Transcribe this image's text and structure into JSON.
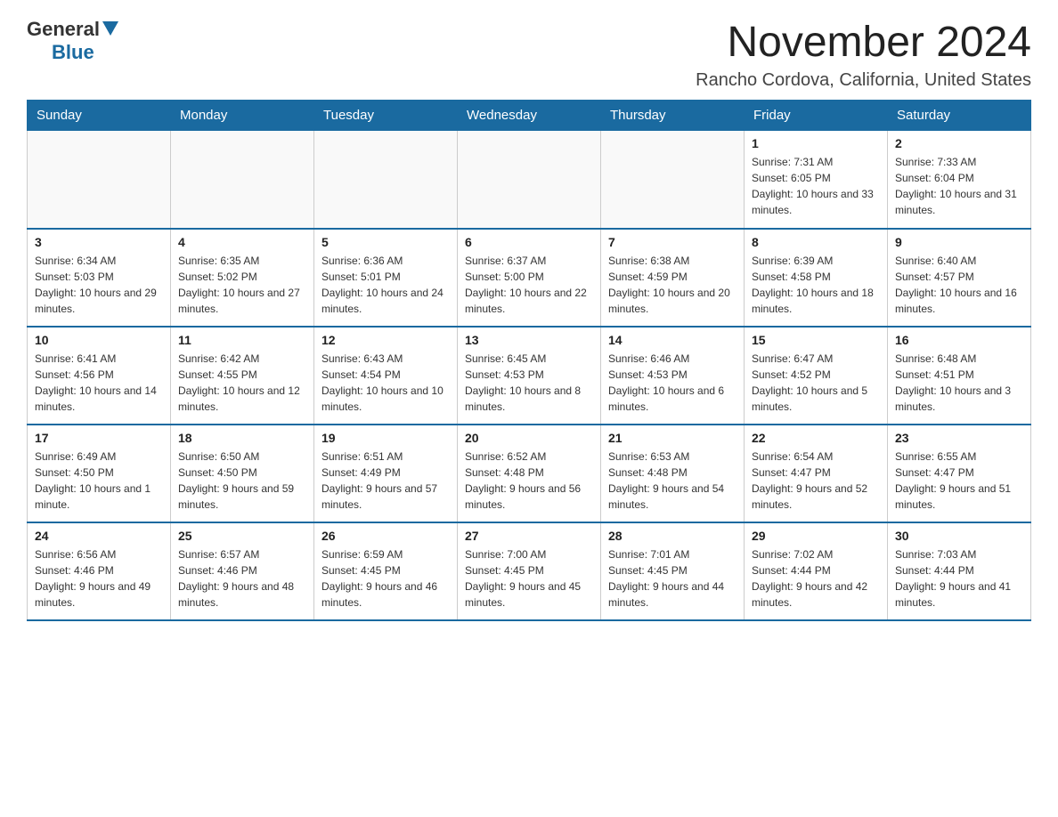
{
  "logo": {
    "general": "General",
    "blue": "Blue"
  },
  "header": {
    "month_title": "November 2024",
    "location": "Rancho Cordova, California, United States"
  },
  "days_of_week": [
    "Sunday",
    "Monday",
    "Tuesday",
    "Wednesday",
    "Thursday",
    "Friday",
    "Saturday"
  ],
  "weeks": [
    [
      {
        "day": "",
        "sunrise": "",
        "sunset": "",
        "daylight": ""
      },
      {
        "day": "",
        "sunrise": "",
        "sunset": "",
        "daylight": ""
      },
      {
        "day": "",
        "sunrise": "",
        "sunset": "",
        "daylight": ""
      },
      {
        "day": "",
        "sunrise": "",
        "sunset": "",
        "daylight": ""
      },
      {
        "day": "",
        "sunrise": "",
        "sunset": "",
        "daylight": ""
      },
      {
        "day": "1",
        "sunrise": "Sunrise: 7:31 AM",
        "sunset": "Sunset: 6:05 PM",
        "daylight": "Daylight: 10 hours and 33 minutes."
      },
      {
        "day": "2",
        "sunrise": "Sunrise: 7:33 AM",
        "sunset": "Sunset: 6:04 PM",
        "daylight": "Daylight: 10 hours and 31 minutes."
      }
    ],
    [
      {
        "day": "3",
        "sunrise": "Sunrise: 6:34 AM",
        "sunset": "Sunset: 5:03 PM",
        "daylight": "Daylight: 10 hours and 29 minutes."
      },
      {
        "day": "4",
        "sunrise": "Sunrise: 6:35 AM",
        "sunset": "Sunset: 5:02 PM",
        "daylight": "Daylight: 10 hours and 27 minutes."
      },
      {
        "day": "5",
        "sunrise": "Sunrise: 6:36 AM",
        "sunset": "Sunset: 5:01 PM",
        "daylight": "Daylight: 10 hours and 24 minutes."
      },
      {
        "day": "6",
        "sunrise": "Sunrise: 6:37 AM",
        "sunset": "Sunset: 5:00 PM",
        "daylight": "Daylight: 10 hours and 22 minutes."
      },
      {
        "day": "7",
        "sunrise": "Sunrise: 6:38 AM",
        "sunset": "Sunset: 4:59 PM",
        "daylight": "Daylight: 10 hours and 20 minutes."
      },
      {
        "day": "8",
        "sunrise": "Sunrise: 6:39 AM",
        "sunset": "Sunset: 4:58 PM",
        "daylight": "Daylight: 10 hours and 18 minutes."
      },
      {
        "day": "9",
        "sunrise": "Sunrise: 6:40 AM",
        "sunset": "Sunset: 4:57 PM",
        "daylight": "Daylight: 10 hours and 16 minutes."
      }
    ],
    [
      {
        "day": "10",
        "sunrise": "Sunrise: 6:41 AM",
        "sunset": "Sunset: 4:56 PM",
        "daylight": "Daylight: 10 hours and 14 minutes."
      },
      {
        "day": "11",
        "sunrise": "Sunrise: 6:42 AM",
        "sunset": "Sunset: 4:55 PM",
        "daylight": "Daylight: 10 hours and 12 minutes."
      },
      {
        "day": "12",
        "sunrise": "Sunrise: 6:43 AM",
        "sunset": "Sunset: 4:54 PM",
        "daylight": "Daylight: 10 hours and 10 minutes."
      },
      {
        "day": "13",
        "sunrise": "Sunrise: 6:45 AM",
        "sunset": "Sunset: 4:53 PM",
        "daylight": "Daylight: 10 hours and 8 minutes."
      },
      {
        "day": "14",
        "sunrise": "Sunrise: 6:46 AM",
        "sunset": "Sunset: 4:53 PM",
        "daylight": "Daylight: 10 hours and 6 minutes."
      },
      {
        "day": "15",
        "sunrise": "Sunrise: 6:47 AM",
        "sunset": "Sunset: 4:52 PM",
        "daylight": "Daylight: 10 hours and 5 minutes."
      },
      {
        "day": "16",
        "sunrise": "Sunrise: 6:48 AM",
        "sunset": "Sunset: 4:51 PM",
        "daylight": "Daylight: 10 hours and 3 minutes."
      }
    ],
    [
      {
        "day": "17",
        "sunrise": "Sunrise: 6:49 AM",
        "sunset": "Sunset: 4:50 PM",
        "daylight": "Daylight: 10 hours and 1 minute."
      },
      {
        "day": "18",
        "sunrise": "Sunrise: 6:50 AM",
        "sunset": "Sunset: 4:50 PM",
        "daylight": "Daylight: 9 hours and 59 minutes."
      },
      {
        "day": "19",
        "sunrise": "Sunrise: 6:51 AM",
        "sunset": "Sunset: 4:49 PM",
        "daylight": "Daylight: 9 hours and 57 minutes."
      },
      {
        "day": "20",
        "sunrise": "Sunrise: 6:52 AM",
        "sunset": "Sunset: 4:48 PM",
        "daylight": "Daylight: 9 hours and 56 minutes."
      },
      {
        "day": "21",
        "sunrise": "Sunrise: 6:53 AM",
        "sunset": "Sunset: 4:48 PM",
        "daylight": "Daylight: 9 hours and 54 minutes."
      },
      {
        "day": "22",
        "sunrise": "Sunrise: 6:54 AM",
        "sunset": "Sunset: 4:47 PM",
        "daylight": "Daylight: 9 hours and 52 minutes."
      },
      {
        "day": "23",
        "sunrise": "Sunrise: 6:55 AM",
        "sunset": "Sunset: 4:47 PM",
        "daylight": "Daylight: 9 hours and 51 minutes."
      }
    ],
    [
      {
        "day": "24",
        "sunrise": "Sunrise: 6:56 AM",
        "sunset": "Sunset: 4:46 PM",
        "daylight": "Daylight: 9 hours and 49 minutes."
      },
      {
        "day": "25",
        "sunrise": "Sunrise: 6:57 AM",
        "sunset": "Sunset: 4:46 PM",
        "daylight": "Daylight: 9 hours and 48 minutes."
      },
      {
        "day": "26",
        "sunrise": "Sunrise: 6:59 AM",
        "sunset": "Sunset: 4:45 PM",
        "daylight": "Daylight: 9 hours and 46 minutes."
      },
      {
        "day": "27",
        "sunrise": "Sunrise: 7:00 AM",
        "sunset": "Sunset: 4:45 PM",
        "daylight": "Daylight: 9 hours and 45 minutes."
      },
      {
        "day": "28",
        "sunrise": "Sunrise: 7:01 AM",
        "sunset": "Sunset: 4:45 PM",
        "daylight": "Daylight: 9 hours and 44 minutes."
      },
      {
        "day": "29",
        "sunrise": "Sunrise: 7:02 AM",
        "sunset": "Sunset: 4:44 PM",
        "daylight": "Daylight: 9 hours and 42 minutes."
      },
      {
        "day": "30",
        "sunrise": "Sunrise: 7:03 AM",
        "sunset": "Sunset: 4:44 PM",
        "daylight": "Daylight: 9 hours and 41 minutes."
      }
    ]
  ]
}
